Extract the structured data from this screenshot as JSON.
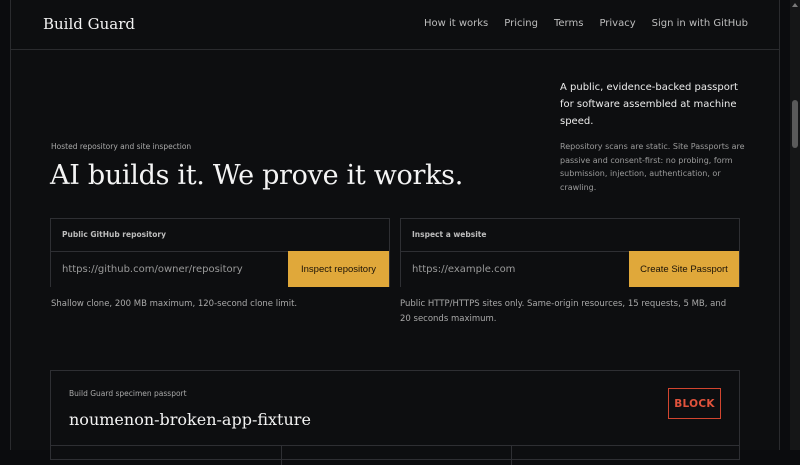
{
  "brand": "Build Guard",
  "nav": [
    "How it works",
    "Pricing",
    "Terms",
    "Privacy",
    "Sign in with GitHub"
  ],
  "hero": {
    "eyebrow": "Hosted repository and site inspection",
    "title": "AI builds it. We prove it works.",
    "side_lead": "A public, evidence-backed passport for software assembled at machine speed.",
    "side_note": "Repository scans are static. Site Passports are passive and consent-first: no probing, form submission, injection, authentication, or crawling."
  },
  "repo_panel": {
    "label": "Public GitHub repository",
    "placeholder": "https://github.com/owner/repository",
    "button": "Inspect repository",
    "help": "Shallow clone, 200 MB maximum, 120-second clone limit."
  },
  "site_panel": {
    "label": "Inspect a website",
    "placeholder": "https://example.com",
    "button": "Create Site Passport",
    "help": "Public HTTP/HTTPS sites only. Same-origin resources, 15 requests, 5 MB, and 20 seconds maximum."
  },
  "specimen": {
    "label": "Build Guard specimen passport",
    "title": "noumenon-broken-app-fixture",
    "badge": "BLOCK"
  },
  "colors": {
    "accent": "#e0a83a",
    "danger": "#d2452f",
    "background": "#0b0c0e"
  }
}
